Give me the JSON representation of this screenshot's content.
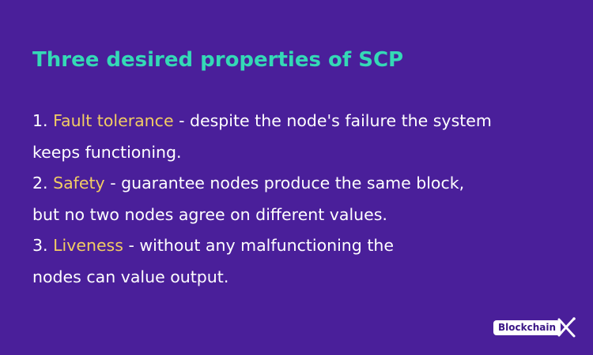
{
  "slide": {
    "title": "Three desired properties of SCP",
    "items": [
      {
        "number": "1.",
        "term": "Fault tolerance",
        "line1_rest": " - despite the node's failure the system",
        "line2": "keeps functioning."
      },
      {
        "number": "2.",
        "term": "Safety",
        "line1_rest": " - guarantee nodes produce the same block,",
        "line2": "but no two nodes agree on different values."
      },
      {
        "number": "3.",
        "term": "Liveness",
        "line1_rest": " - without any malfunctioning the",
        "line2": "nodes can value output."
      }
    ]
  },
  "logo": {
    "text": "Blockchain",
    "icon": "x-mark-icon"
  },
  "colors": {
    "background": "#4a1f9a",
    "title": "#34d9b6",
    "highlight": "#f2cc63",
    "text": "#ffffff"
  }
}
